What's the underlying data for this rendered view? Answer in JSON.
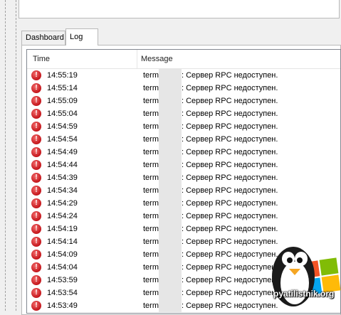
{
  "tabs": [
    {
      "label": "Dashboard"
    },
    {
      "label": "Log"
    }
  ],
  "log": {
    "columns": {
      "time": "Time",
      "message": "Message"
    },
    "rows": [
      {
        "time": "14:55:19",
        "source": "term",
        "message": ": Сервер RPC недоступен."
      },
      {
        "time": "14:55:14",
        "source": "term",
        "message": ": Сервер RPC недоступен."
      },
      {
        "time": "14:55:09",
        "source": "term",
        "message": ": Сервер RPC недоступен."
      },
      {
        "time": "14:55:04",
        "source": "term",
        "message": ": Сервер RPC недоступен."
      },
      {
        "time": "14:54:59",
        "source": "term",
        "message": ": Сервер RPC недоступен."
      },
      {
        "time": "14:54:54",
        "source": "term",
        "message": ": Сервер RPC недоступен."
      },
      {
        "time": "14:54:49",
        "source": "term",
        "message": ": Сервер RPC недоступен."
      },
      {
        "time": "14:54:44",
        "source": "term",
        "message": ": Сервер RPC недоступен."
      },
      {
        "time": "14:54:39",
        "source": "term",
        "message": ": Сервер RPC недоступен."
      },
      {
        "time": "14:54:34",
        "source": "term",
        "message": ": Сервер RPC недоступен."
      },
      {
        "time": "14:54:29",
        "source": "term",
        "message": ": Сервер RPC недоступен."
      },
      {
        "time": "14:54:24",
        "source": "term",
        "message": ": Сервер RPC недоступен."
      },
      {
        "time": "14:54:19",
        "source": "term",
        "message": ": Сервер RPC недоступен."
      },
      {
        "time": "14:54:14",
        "source": "term",
        "message": ": Сервер RPC недоступен."
      },
      {
        "time": "14:54:09",
        "source": "term",
        "message": ": Сервер RPC недоступен."
      },
      {
        "time": "14:54:04",
        "source": "term",
        "message": ": Сервер RPC недоступен."
      },
      {
        "time": "14:53:59",
        "source": "term",
        "message": ": Сервер RPC недоступен."
      },
      {
        "time": "14:53:54",
        "source": "term",
        "message": ": Сервер RPC недоступен."
      },
      {
        "time": "14:53:49",
        "source": "term",
        "message": ": Сервер RPC недоступен."
      }
    ]
  },
  "watermark": {
    "text": "pyatilistnik.org"
  },
  "colors": {
    "error": "#c4151b",
    "selected_tab": "#ffffff",
    "panel_border": "#b9b9b9"
  },
  "icons": {
    "row_icon": "error-icon"
  }
}
